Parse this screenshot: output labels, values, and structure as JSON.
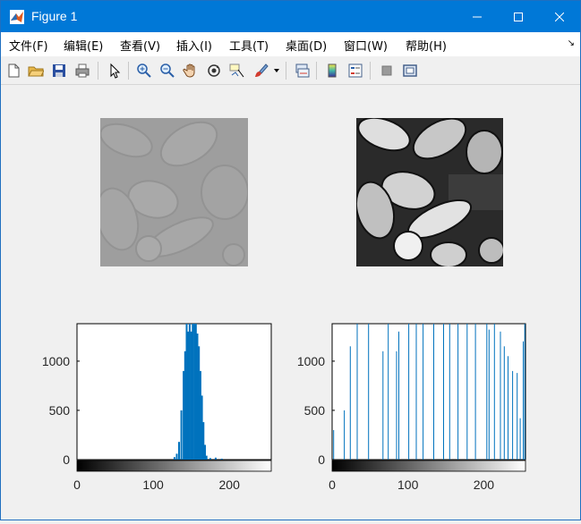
{
  "window": {
    "title": "Figure 1"
  },
  "menu": [
    "文件(F)",
    "编辑(E)",
    "查看(V)",
    "插入(I)",
    "工具(T)",
    "桌面(D)",
    "窗口(W)",
    "帮助(H)"
  ],
  "toolbar_icons": [
    "new-figure-icon",
    "open-file-icon",
    "save-icon",
    "print-icon",
    "select-arrow-icon",
    "zoom-in-icon",
    "zoom-out-icon",
    "pan-hand-icon",
    "rotate-3d-icon",
    "data-cursor-icon",
    "brush-icon",
    "link-plot-icon",
    "colorbar-icon",
    "legend-icon",
    "hide-plot-tools-icon",
    "show-plot-tools-icon"
  ],
  "colors": {
    "titlebar": "#0078d7",
    "bar": "#0072bd",
    "axes_bg": "#ffffff"
  },
  "chart_data": [
    {
      "type": "heatmap",
      "description_role": "image",
      "subplot": "top-left"
    },
    {
      "type": "heatmap",
      "description_role": "image",
      "subplot": "top-right"
    },
    {
      "type": "bar",
      "subplot": "bottom-left",
      "xlim": [
        0,
        255
      ],
      "ylim": [
        0,
        1380
      ],
      "xticks": [
        "0",
        "100",
        "200"
      ],
      "yticks": [
        "0",
        "500",
        "1000"
      ],
      "colorbar": "grayscale",
      "x": [
        128,
        131,
        134,
        137,
        140,
        142,
        144,
        146,
        148,
        150,
        152,
        154,
        156,
        158,
        160,
        162,
        164,
        166,
        168,
        170,
        175,
        182,
        190
      ],
      "values": [
        25,
        60,
        180,
        500,
        900,
        1100,
        1380,
        1300,
        1380,
        1300,
        1380,
        1380,
        1380,
        1280,
        1150,
        900,
        650,
        380,
        150,
        40,
        15,
        20,
        10
      ]
    },
    {
      "type": "bar",
      "subplot": "bottom-right",
      "xlim": [
        0,
        255
      ],
      "ylim": [
        0,
        1380
      ],
      "xticks": [
        "0",
        "100",
        "200"
      ],
      "yticks": [
        "0",
        "500",
        "1000"
      ],
      "colorbar": "grayscale",
      "x": [
        2,
        16,
        24,
        33,
        48,
        67,
        74,
        85,
        88,
        101,
        111,
        120,
        134,
        147,
        155,
        166,
        178,
        189,
        204,
        207,
        214,
        222,
        227,
        232,
        238,
        244,
        248,
        252,
        254
      ],
      "values": [
        300,
        500,
        1150,
        1380,
        1380,
        1100,
        1380,
        1100,
        1300,
        1380,
        1380,
        1380,
        1380,
        1380,
        1380,
        1380,
        1380,
        1380,
        1380,
        1320,
        1380,
        1300,
        1150,
        1050,
        900,
        880,
        420,
        1200,
        1380
      ]
    }
  ]
}
